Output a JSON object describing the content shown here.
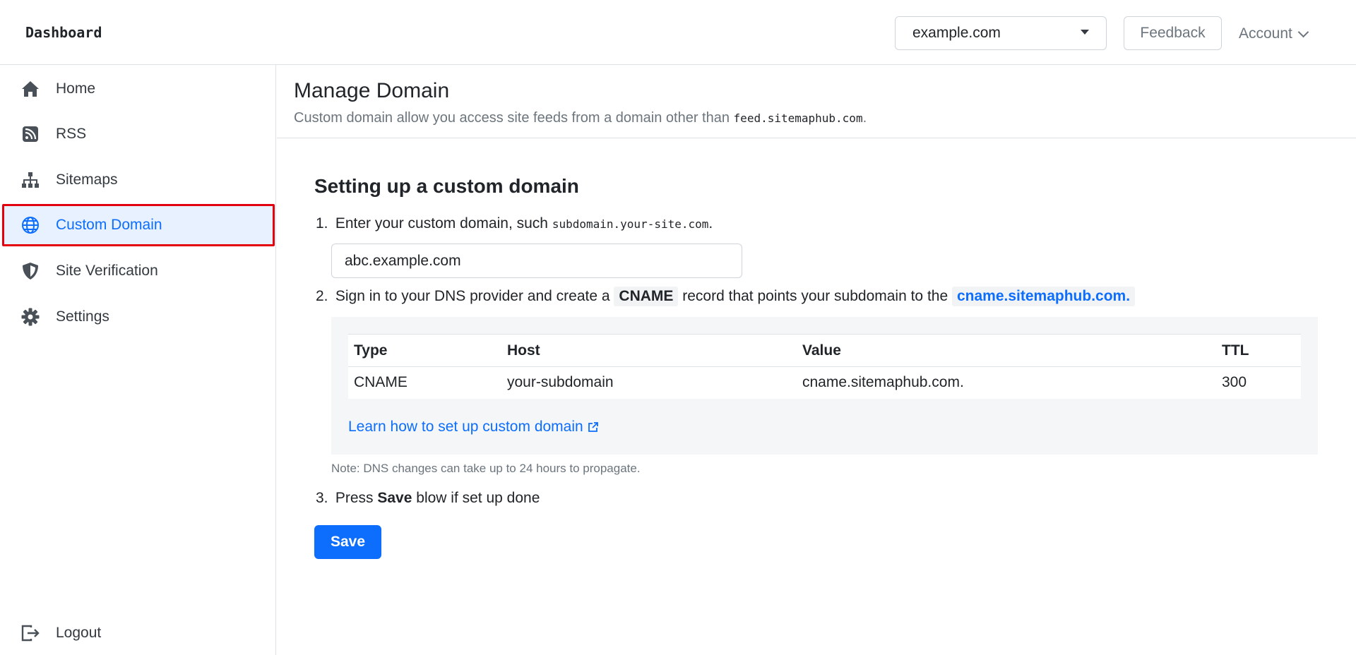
{
  "header": {
    "brand": "Dashboard",
    "site_select": {
      "value": "example.com"
    },
    "feedback_label": "Feedback",
    "account_label": "Account"
  },
  "sidebar": {
    "items": [
      {
        "label": "Home",
        "icon": "home-icon"
      },
      {
        "label": "RSS",
        "icon": "rss-icon"
      },
      {
        "label": "Sitemaps",
        "icon": "sitemap-icon"
      },
      {
        "label": "Custom Domain",
        "icon": "globe-icon",
        "active": true
      },
      {
        "label": "Site Verification",
        "icon": "shield-icon"
      },
      {
        "label": "Settings",
        "icon": "gear-icon"
      }
    ],
    "logout_label": "Logout"
  },
  "page": {
    "title": "Manage Domain",
    "desc_prefix": "Custom domain allow you access site feeds from a domain other than",
    "desc_code": "feed.sitemaphub.com",
    "desc_suffix": "."
  },
  "setup": {
    "title": "Setting up a custom domain",
    "step1": {
      "num": "1.",
      "text": "Enter your custom domain, such",
      "code": "subdomain.your-site.com",
      "suffix": "."
    },
    "domain_input": {
      "value": "abc.example.com"
    },
    "step2": {
      "num": "2.",
      "prefix": "Sign in to your DNS provider and create a",
      "code": "CNAME",
      "middle": "record that points your subdomain to the",
      "target": "cname.sitemaphub.com."
    },
    "table": {
      "headers": [
        "Type",
        "Host",
        "Value",
        "TTL"
      ],
      "rows": [
        [
          "CNAME",
          "your-subdomain",
          "cname.sitemaphub.com.",
          "300"
        ]
      ]
    },
    "learn_link": "Learn how to set up custom domain",
    "note": "Note: DNS changes can take up to 24 hours to propagate.",
    "step3": {
      "num": "3.",
      "prefix": "Press",
      "bold": "Save",
      "suffix": "blow if set up done"
    },
    "save_label": "Save"
  },
  "colors": {
    "primary": "#0d6efd",
    "active_bg": "#e7f1ff",
    "highlight_border": "#e3000f"
  }
}
